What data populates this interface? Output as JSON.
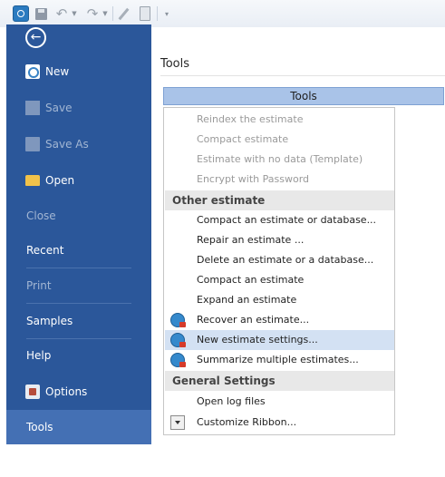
{
  "qat": {
    "icons": [
      "app-icon",
      "save-icon",
      "undo-icon",
      "redo-icon",
      "edit-icon",
      "clipboard-icon",
      "customize-icon"
    ]
  },
  "nav": {
    "back_icon": "←",
    "items": [
      {
        "label": "New",
        "state": "normal"
      },
      {
        "label": "Save",
        "state": "disabled"
      },
      {
        "label": "Save As",
        "state": "disabled"
      },
      {
        "label": "Open",
        "state": "normal"
      },
      {
        "label": "Close",
        "state": "disabled"
      },
      {
        "label": "Recent",
        "state": "normal"
      },
      {
        "label": "Print",
        "state": "disabled"
      },
      {
        "label": "Samples",
        "state": "normal"
      },
      {
        "label": "Help",
        "state": "normal"
      },
      {
        "label": "Options",
        "state": "normal"
      },
      {
        "label": "Tools",
        "state": "selected"
      }
    ]
  },
  "main": {
    "title": "Tools",
    "tools_button": "Tools"
  },
  "menu": {
    "items": [
      {
        "label": "Reindex the estimate",
        "state": "disabled"
      },
      {
        "label": "Compact estimate",
        "state": "disabled"
      },
      {
        "label": "Estimate with no data (Template)",
        "state": "disabled"
      },
      {
        "label": "Encrypt with Password",
        "state": "disabled"
      },
      {
        "label": "Other estimate",
        "type": "header"
      },
      {
        "label": "Compact an estimate or database...",
        "state": "normal"
      },
      {
        "label": "Repair an estimate ...",
        "state": "normal"
      },
      {
        "label": "Delete an estimate or a database...",
        "state": "normal"
      },
      {
        "label": "Compact an estimate",
        "state": "normal"
      },
      {
        "label": "Expand an estimate",
        "state": "normal"
      },
      {
        "label": "Recover an estimate...",
        "state": "normal",
        "icon": "estimate-icon"
      },
      {
        "label": "New estimate settings...",
        "state": "hover",
        "icon": "estimate-icon"
      },
      {
        "label": "Summarize multiple estimates...",
        "state": "normal",
        "icon": "estimate-icon"
      },
      {
        "label": "General Settings",
        "type": "header"
      },
      {
        "label": "Open log files",
        "state": "normal"
      },
      {
        "label": "Customize Ribbon...",
        "state": "normal",
        "icon": "customize-icon"
      }
    ]
  }
}
